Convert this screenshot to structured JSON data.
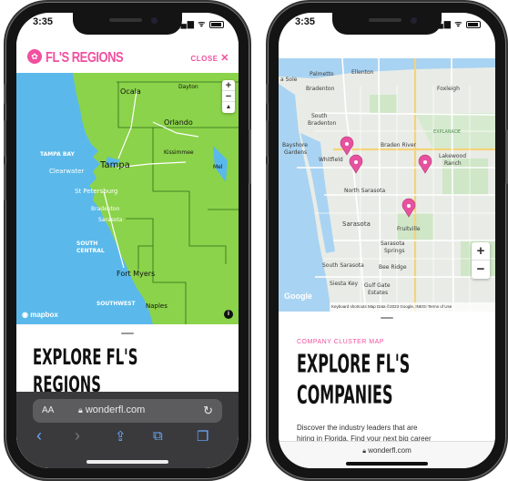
{
  "left_phone": {
    "status": {
      "time": "3:35",
      "signal": "▂▄▆ ᯤ"
    },
    "header": {
      "logo_text": "FL'S REGIONS",
      "close_label": "CLOSE"
    },
    "map": {
      "labels": [
        "Ocala",
        "Dayton",
        "Orlando",
        "TAMPA BAY",
        "Tampa",
        "Clearwater",
        "Kissimmee",
        "Mel",
        "St Petersburg",
        "Bradenton",
        "Sarasota",
        "SOUTH",
        "CENTRAL",
        "Fort Myers",
        "SOUTHWEST",
        "Naples"
      ],
      "attribution": "mapbox",
      "zoom_in": "+",
      "zoom_out": "−",
      "compass": "▲",
      "info": "i"
    },
    "title_line1": "EXPLORE FL'S",
    "title_line2": "REGIONS",
    "safari": {
      "text_size": "AA",
      "url": "wonderfl.com",
      "reload": "↻",
      "back": "‹",
      "forward": "›",
      "share": "⇪",
      "bookmarks": "⧉",
      "tabs": "❐"
    }
  },
  "right_phone": {
    "status": {
      "time": "3:35",
      "signal": "▂▄▆ ᯤ"
    },
    "map": {
      "labels": [
        "Palmetto",
        "Ellenton",
        "a Sole",
        "Bradenton",
        "Foxleigh",
        "South",
        "Bradenton",
        "Bayshore",
        "Gardens",
        "Whitfield",
        "Braden River",
        "Lakewood",
        "Ranch",
        "North Sarasota",
        "Sarasota",
        "Fruitville",
        "Sarasota",
        "Springs",
        "South Sarasota",
        "Bee Ridge",
        "Siesta Key",
        "Gulf Gate",
        "Estates",
        "EXPLANADE"
      ],
      "attribution": "Google",
      "footer_text": "Keyboard shortcuts  Map Data ©2023 Google, INEGI  Terms of Use",
      "zoom_in": "+",
      "zoom_out": "−"
    },
    "eyebrow": "COMPANY CLUSTER MAP",
    "title_line1": "EXPLORE FL'S",
    "title_line2": "COMPANIES",
    "body_line1": "Discover the industry leaders that are",
    "body_line2": "hiring in Florida. Find your next big career",
    "url": "wonderfl.com"
  },
  "colors": {
    "brand_pink": "#f0509f",
    "land_green": "#8bd34a",
    "water_blue": "#5ab9ea",
    "safari_bar": "#3a3a3c"
  }
}
